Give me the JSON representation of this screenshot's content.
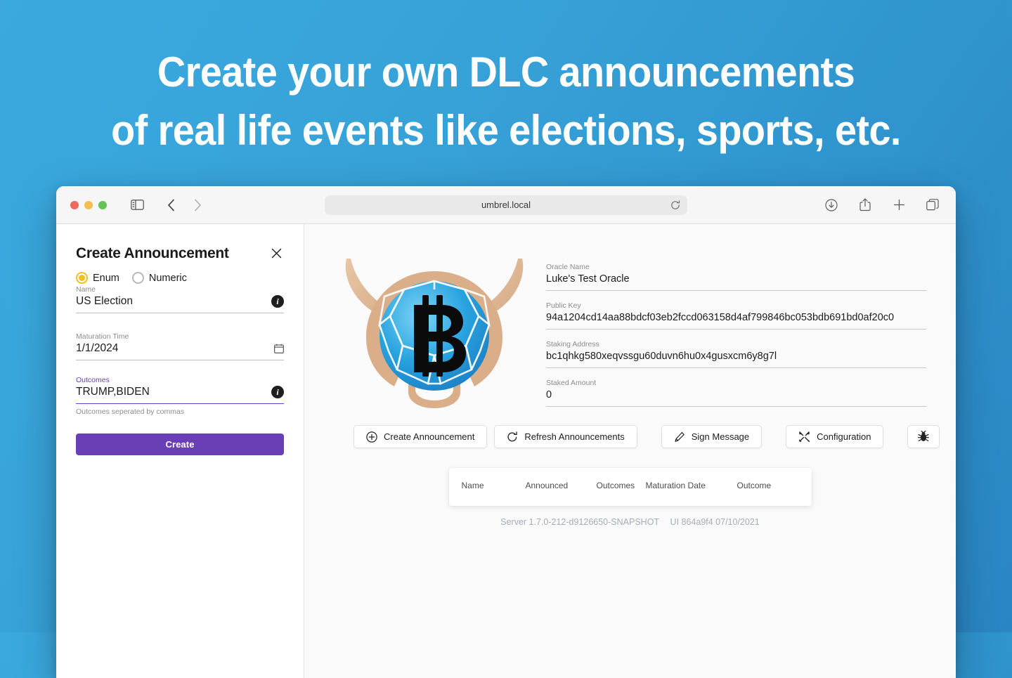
{
  "promo": {
    "headline_line1": "Create your own DLC announcements",
    "headline_line2": "of real life events like elections, sports, etc.",
    "background_start": "#3aa9df",
    "background_end": "#2a85c4"
  },
  "browser": {
    "url": "umbrel.local",
    "icons": {
      "sidebar_toggle": "sidebar-toggle-icon",
      "back": "back-chevron-icon",
      "forward": "forward-chevron-icon",
      "shield": "privacy-shield-icon",
      "reload": "reload-icon",
      "downloads": "downloads-icon",
      "share": "share-icon",
      "new_tab": "plus-icon",
      "tab_overview": "tab-overview-icon"
    }
  },
  "create_panel": {
    "title": "Create Announcement",
    "close_label": "×",
    "type_options": [
      {
        "label": "Enum",
        "selected": true
      },
      {
        "label": "Numeric",
        "selected": false
      }
    ],
    "name": {
      "label": "Name",
      "value": "US Election",
      "info": "i"
    },
    "maturation": {
      "label": "Maturation Time",
      "value": "1/1/2024"
    },
    "outcomes": {
      "label": "Outcomes",
      "value": "TRUMP,BIDEN",
      "hint": "Outcomes seperated by commas",
      "info": "i",
      "accent_color": "#6a3fb5"
    },
    "create_button": "Create",
    "create_button_color": "#6a3fb5"
  },
  "oracle": {
    "name": {
      "label": "Oracle Name",
      "value": "Luke's Test Oracle"
    },
    "public_key": {
      "label": "Public Key",
      "value": "94a1204cd14aa88bdcf03eb2fccd063158d4af799846bc053bdb691bd0af20c0"
    },
    "staking_address": {
      "label": "Staking Address",
      "value": "bc1qhkg580xeqvssgu60duvn6hu0x4gusxcm6y8g7l"
    },
    "staked_amount": {
      "label": "Staked Amount",
      "value": "0"
    }
  },
  "actions": [
    {
      "label": "Create Announcement",
      "icon": "plus-circle-icon"
    },
    {
      "label": "Refresh Announcements",
      "icon": "refresh-icon"
    },
    {
      "label": "Sign Message",
      "icon": "pencil-icon"
    },
    {
      "label": "Configuration",
      "icon": "tools-icon"
    },
    {
      "label": "",
      "icon": "bug-icon"
    }
  ],
  "announcements_table": {
    "columns": [
      "Name",
      "Announced",
      "Outcomes",
      "Maturation Date",
      "Outcome"
    ],
    "rows": []
  },
  "footer": {
    "server": "Server 1.7.0-212-d9126650-SNAPSHOT",
    "ui": "UI 864a9f4 07/10/2021"
  }
}
